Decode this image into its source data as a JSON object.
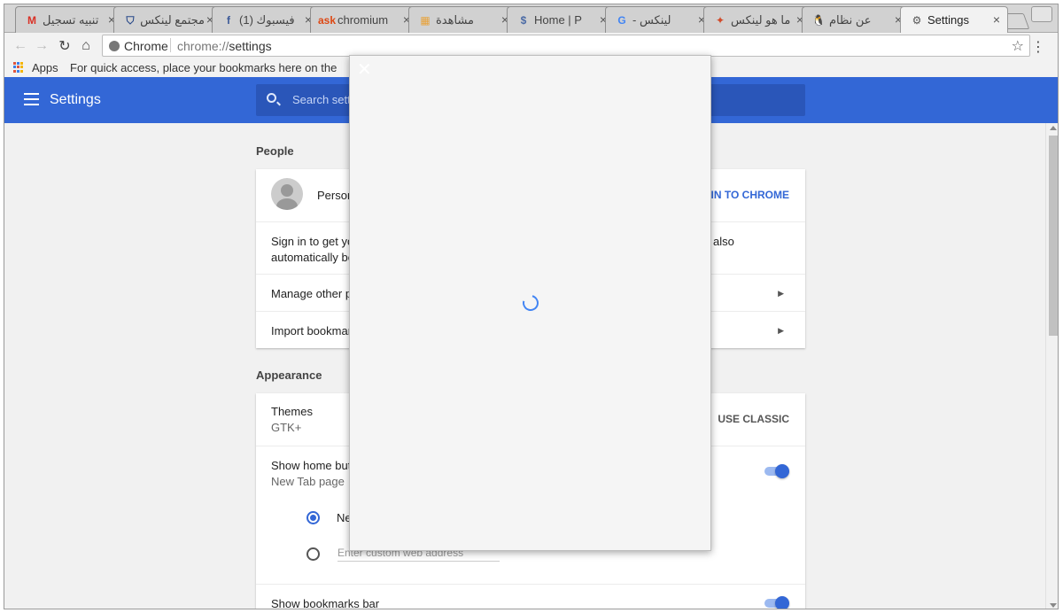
{
  "tabs": [
    {
      "title": "تنبيه تسجيل",
      "icon": "gmail-icon",
      "icon_char": "M",
      "color": "#d93025"
    },
    {
      "title": "مجتمع لينكس",
      "icon": "shield-icon",
      "icon_char": "⛉",
      "color": "#2a4a8a"
    },
    {
      "title": "فيسبوك (1)",
      "icon": "facebook-icon",
      "icon_char": "f",
      "color": "#3b5998"
    },
    {
      "title": "chromium",
      "icon": "askubuntu-icon",
      "icon_char": "ask",
      "color": "#dd4814"
    },
    {
      "title": "مشاهدة",
      "icon": "site-favicon",
      "icon_char": "▦",
      "color": "#e8a33c"
    },
    {
      "title": "Home | P",
      "icon": "dollar-site-icon",
      "icon_char": "$",
      "color": "#4a6aa5"
    },
    {
      "title": "لينكس -",
      "icon": "google-icon",
      "icon_char": "G",
      "color": "#4285f4"
    },
    {
      "title": "ما هو لينكس",
      "icon": "site-favicon-red",
      "icon_char": "✦",
      "color": "#d14b2a"
    },
    {
      "title": "عن نظام",
      "icon": "tux-icon",
      "icon_char": "🐧",
      "color": "#222"
    },
    {
      "title": "Settings",
      "icon": "gear-icon",
      "icon_char": "⚙",
      "color": "#555",
      "active": true
    }
  ],
  "toolbar": {
    "chip": "Chrome",
    "url_prefix": "chrome://",
    "url_path": "settings"
  },
  "bookmarks": {
    "apps_label": "Apps",
    "hint": "For quick access, place your bookmarks here on the"
  },
  "header": {
    "title": "Settings",
    "search_placeholder": "Search setti"
  },
  "people": {
    "section_label": "People",
    "person_name": "Person",
    "signin_button": "N IN TO CHROME",
    "signin_text_1": "Sign in to get you",
    "signin_text_2": "automatically be",
    "signin_text_right": "also",
    "manage_label": "Manage other pe",
    "import_label": "Import bookmark"
  },
  "appearance": {
    "section_label": "Appearance",
    "themes_label": "Themes",
    "themes_value": "GTK+",
    "classic_button": "USE CLASSIC",
    "home_button_label": "Show home butt",
    "home_button_sub": "New Tab page",
    "radio_newtab": "Ne",
    "custom_placeholder": "Enter custom web address",
    "bookmarks_bar_label": "Show bookmarks bar"
  },
  "colors": {
    "accent": "#3367d6",
    "header_bg": "#3367d6"
  }
}
